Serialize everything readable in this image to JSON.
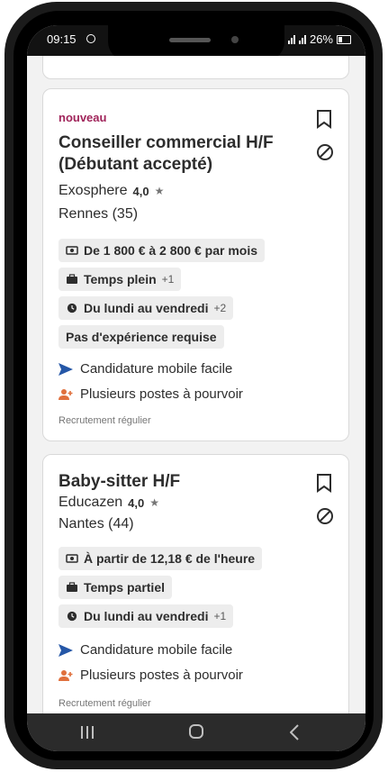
{
  "status_bar": {
    "time": "09:15",
    "battery": "26%"
  },
  "jobs": [
    {
      "badge": "nouveau",
      "title": "Conseiller commercial H/F (Débutant accepté)",
      "company": "Exosphere",
      "rating": "4,0",
      "location": "Rennes (35)",
      "tags": [
        {
          "icon": "salary-icon",
          "label": "De 1 800 € à 2 800 € par mois",
          "more": ""
        },
        {
          "icon": "briefcase-icon",
          "label": "Temps plein",
          "more": "+1"
        },
        {
          "icon": "clock-icon",
          "label": "Du lundi au vendredi",
          "more": "+2"
        },
        {
          "icon": "",
          "label": "Pas d'expérience requise",
          "more": ""
        }
      ],
      "features": [
        {
          "icon": "send-arrow-icon",
          "label": "Candidature mobile facile"
        },
        {
          "icon": "add-person-icon",
          "label": "Plusieurs postes à pourvoir"
        }
      ],
      "footnote": "Recrutement régulier"
    },
    {
      "badge": "",
      "title": "Baby-sitter H/F",
      "company": "Educazen",
      "rating": "4,0",
      "location": "Nantes (44)",
      "tags": [
        {
          "icon": "salary-icon",
          "label": "À partir de 12,18 € de l'heure",
          "more": ""
        },
        {
          "icon": "briefcase-icon",
          "label": "Temps partiel",
          "more": ""
        },
        {
          "icon": "clock-icon",
          "label": "Du lundi au vendredi",
          "more": "+1"
        }
      ],
      "features": [
        {
          "icon": "send-arrow-icon",
          "label": "Candidature mobile facile"
        },
        {
          "icon": "add-person-icon",
          "label": "Plusieurs postes à pourvoir"
        }
      ],
      "footnote": "Recrutement régulier"
    }
  ],
  "colors": {
    "badge": "#a0245a",
    "send_arrow": "#2557a7",
    "person_icon": "#e0703d"
  }
}
